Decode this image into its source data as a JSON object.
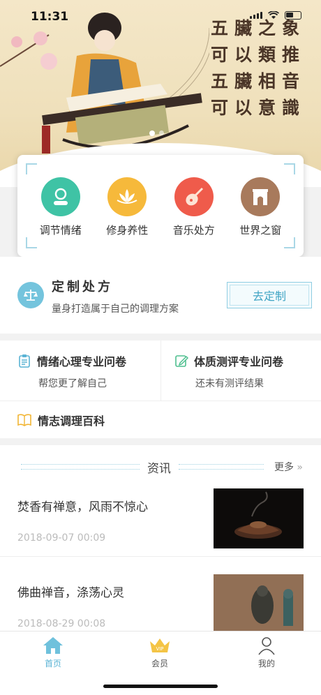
{
  "status": {
    "time": "11:31"
  },
  "banner": {
    "poem": [
      "五臟之象",
      "可以類推",
      "五臟相音",
      "可以意識"
    ],
    "slides": 2
  },
  "nav": [
    {
      "label": "调节情绪",
      "icon": "face-icon",
      "color": "#3fc3a5"
    },
    {
      "label": "修身养性",
      "icon": "lotus-icon",
      "color": "#f6b93b"
    },
    {
      "label": "音乐处方",
      "icon": "pipa-icon",
      "color": "#ef5b4b"
    },
    {
      "label": "世界之窗",
      "icon": "arch-icon",
      "color": "#a87a5c"
    }
  ],
  "prescription": {
    "title": "定制处方",
    "subtitle": "量身打造属于自己的调理方案",
    "button": "去定制"
  },
  "questionnaires": [
    {
      "title": "情绪心理专业问卷",
      "subtitle": "帮您更了解自己"
    },
    {
      "title": "体质测评专业问卷",
      "subtitle": "还未有测评结果"
    }
  ],
  "wiki": {
    "title": "情志调理百科"
  },
  "news": {
    "header": "资讯",
    "more": "更多",
    "items": [
      {
        "title": "焚香有禅意，风雨不惊心",
        "date": "2018-09-07 00:09"
      },
      {
        "title": "佛曲禅音，涤荡心灵",
        "date": "2018-08-29 00:08"
      }
    ]
  },
  "tabs": [
    {
      "label": "首页",
      "active": true
    },
    {
      "label": "会员",
      "active": false
    },
    {
      "label": "我的",
      "active": false
    }
  ],
  "colors": {
    "accent": "#5ab3d4",
    "banner": "#f1e3c2"
  }
}
